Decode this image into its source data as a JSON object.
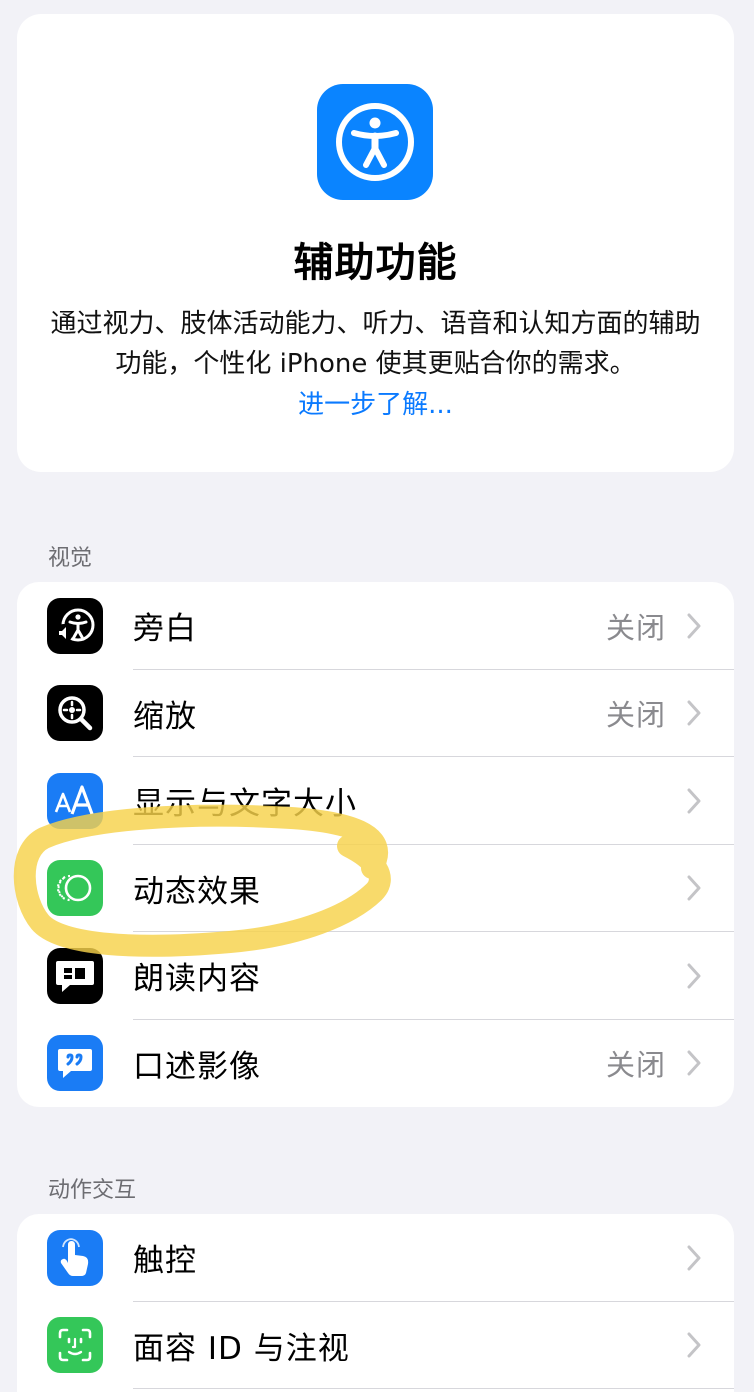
{
  "hero": {
    "title": "辅助功能",
    "description": "通过视力、肢体活动能力、听力、语音和认知方面的辅助功能，个性化 iPhone 使其更贴合你的需求。",
    "learn_more": "进一步了解...",
    "icon": "accessibility-icon",
    "icon_color": "#0a84ff"
  },
  "sections": {
    "vision": {
      "header": "视觉",
      "items": [
        {
          "label": "旁白",
          "value": "关闭",
          "icon": "voiceover-icon",
          "icon_bg": "#000000"
        },
        {
          "label": "缩放",
          "value": "关闭",
          "icon": "zoom-icon",
          "icon_bg": "#000000"
        },
        {
          "label": "显示与文字大小",
          "value": "",
          "icon": "text-size-icon",
          "icon_bg": "#1a7cf5"
        },
        {
          "label": "动态效果",
          "value": "",
          "icon": "motion-icon",
          "icon_bg": "#34c759"
        },
        {
          "label": "朗读内容",
          "value": "",
          "icon": "spoken-content-icon",
          "icon_bg": "#000000"
        },
        {
          "label": "口述影像",
          "value": "关闭",
          "icon": "audio-descriptions-icon",
          "icon_bg": "#1a7cf5"
        }
      ]
    },
    "interaction": {
      "header": "动作交互",
      "items": [
        {
          "label": "触控",
          "value": "",
          "icon": "touch-icon",
          "icon_bg": "#1a7cf5"
        },
        {
          "label": "面容 ID 与注视",
          "value": "",
          "icon": "face-id-icon",
          "icon_bg": "#34c759"
        }
      ]
    }
  },
  "highlight_color": "#f7d24a"
}
